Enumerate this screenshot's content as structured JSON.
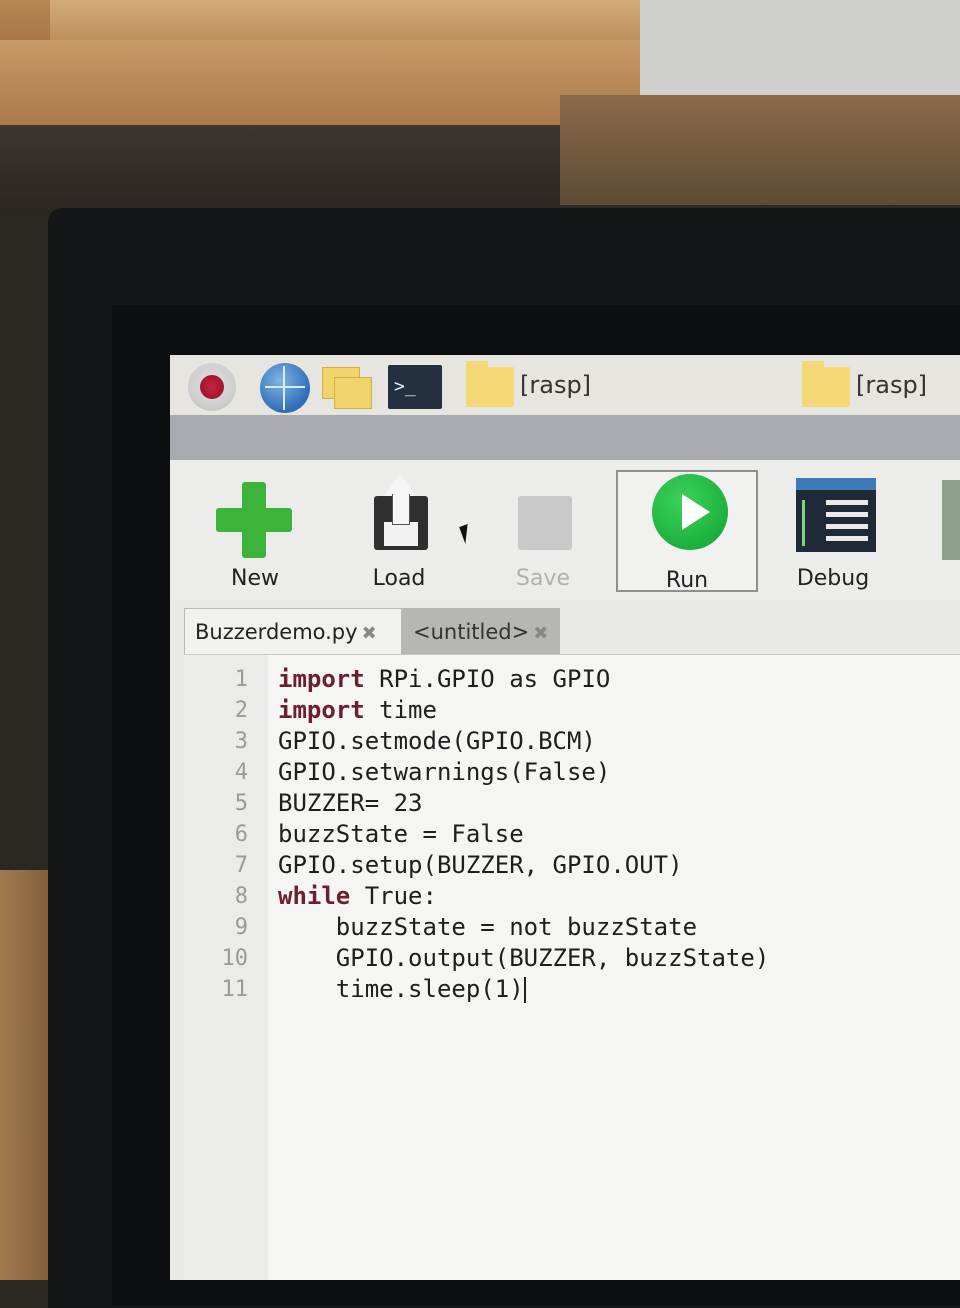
{
  "taskbar": {
    "folder1_label": "[rasp]",
    "folder2_label": "[rasp]",
    "terminal_glyph": ">_"
  },
  "toolbar": {
    "new": "New",
    "load": "Load",
    "save": "Save",
    "run": "Run",
    "debug": "Debug"
  },
  "tabs": [
    {
      "label": "Buzzerdemo.py",
      "close": "✖"
    },
    {
      "label": "<untitled>",
      "close": "✖"
    }
  ],
  "editor": {
    "line_numbers": [
      "1",
      "2",
      "3",
      "4",
      "5",
      "6",
      "7",
      "8",
      "9",
      "10",
      "11"
    ],
    "lines": [
      {
        "kw": "import",
        "rest": " RPi.GPIO as GPIO"
      },
      {
        "kw": "import",
        "rest": " time"
      },
      {
        "kw": "",
        "rest": "GPIO.setmode(GPIO.BCM)"
      },
      {
        "kw": "",
        "rest": "GPIO.setwarnings(False)"
      },
      {
        "kw": "",
        "rest": "BUZZER= 23"
      },
      {
        "kw": "",
        "rest": "buzzState = False"
      },
      {
        "kw": "",
        "rest": "GPIO.setup(BUZZER, GPIO.OUT)"
      },
      {
        "kw": "while",
        "rest": " True:"
      },
      {
        "kw": "",
        "rest": "    buzzState = not buzzState"
      },
      {
        "kw": "",
        "rest": "    GPIO.output(BUZZER, buzzState)"
      },
      {
        "kw": "",
        "rest": "    time.sleep(1)"
      }
    ]
  }
}
